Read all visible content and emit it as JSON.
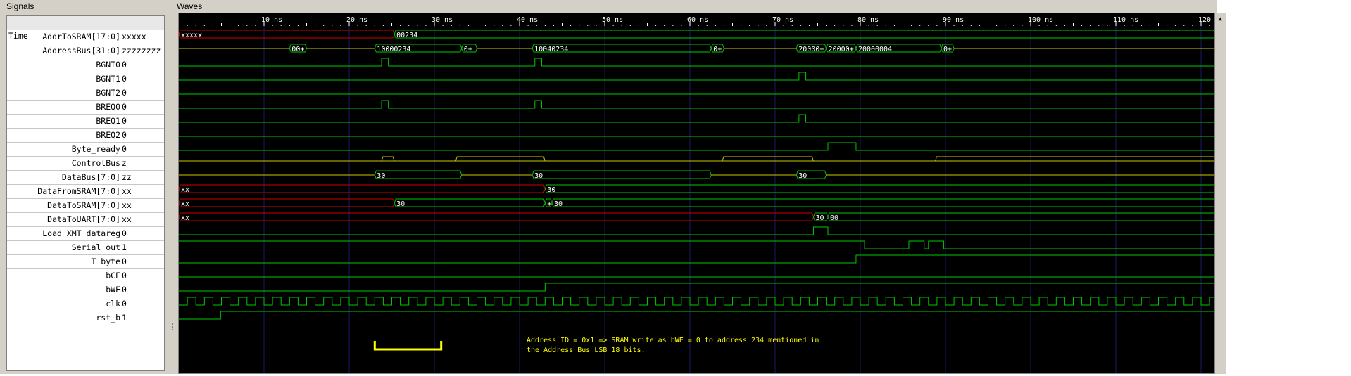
{
  "signals_panel": {
    "title": "Signals",
    "time_header": "Time"
  },
  "waves_panel": {
    "title": "Waves"
  },
  "colors": {
    "wave_green": "#00c800",
    "bus_yellow": "#c8c800",
    "undefined_red": "#d00000",
    "cursor_red": "#ff2020",
    "annotation_yellow": "#ffff00",
    "tick_white": "#ffffff"
  },
  "time_ticks": [
    "10 ns",
    "20 ns",
    "30 ns",
    "40 ns",
    "50 ns",
    "60 ns",
    "70 ns",
    "80 ns",
    "90 ns",
    "100 ns",
    "110 ns",
    "120 ns"
  ],
  "signals": [
    {
      "name": "AddrToSRAM[17:0]",
      "value": "xxxxx"
    },
    {
      "name": "AddressBus[31:0]",
      "value": "zzzzzzzz"
    },
    {
      "name": "BGNT0",
      "value": "0"
    },
    {
      "name": "BGNT1",
      "value": "0"
    },
    {
      "name": "BGNT2",
      "value": "0"
    },
    {
      "name": "BREQ0",
      "value": "0"
    },
    {
      "name": "BREQ1",
      "value": "0"
    },
    {
      "name": "BREQ2",
      "value": "0"
    },
    {
      "name": "Byte_ready",
      "value": "0"
    },
    {
      "name": "ControlBus",
      "value": "z"
    },
    {
      "name": "DataBus[7:0]",
      "value": "zz"
    },
    {
      "name": "DataFromSRAM[7:0]",
      "value": "xx"
    },
    {
      "name": "DataToSRAM[7:0]",
      "value": "xx"
    },
    {
      "name": "DataToUART[7:0]",
      "value": "xx"
    },
    {
      "name": "Load_XMT_datareg",
      "value": "0"
    },
    {
      "name": "Serial_out",
      "value": "1"
    },
    {
      "name": "T_byte",
      "value": "0"
    },
    {
      "name": "bCE",
      "value": "0"
    },
    {
      "name": "bWE",
      "value": "0"
    },
    {
      "name": "clk",
      "value": "0"
    },
    {
      "name": "rst_b",
      "value": "1"
    }
  ],
  "bus_labels": {
    "addr_to_sram": [
      "xxxxx",
      "00234"
    ],
    "address_bus": [
      "00+",
      "10000234",
      "0+",
      "10040234",
      "0+",
      "20000+",
      "20000+",
      "20000004",
      "0+"
    ],
    "data_bus": [
      "30",
      "30",
      "30"
    ],
    "data_from_sram": [
      "xx",
      "30"
    ],
    "data_to_sram": [
      "xx",
      "30",
      "+",
      "30"
    ],
    "data_to_uart": [
      "xx",
      "30",
      "00"
    ]
  },
  "annotation": {
    "line1": "Address ID = 0x1 => SRAM write as bWE = 0 to address 234 mentioned in",
    "line2": "the Address Bus LSB 18 bits."
  }
}
